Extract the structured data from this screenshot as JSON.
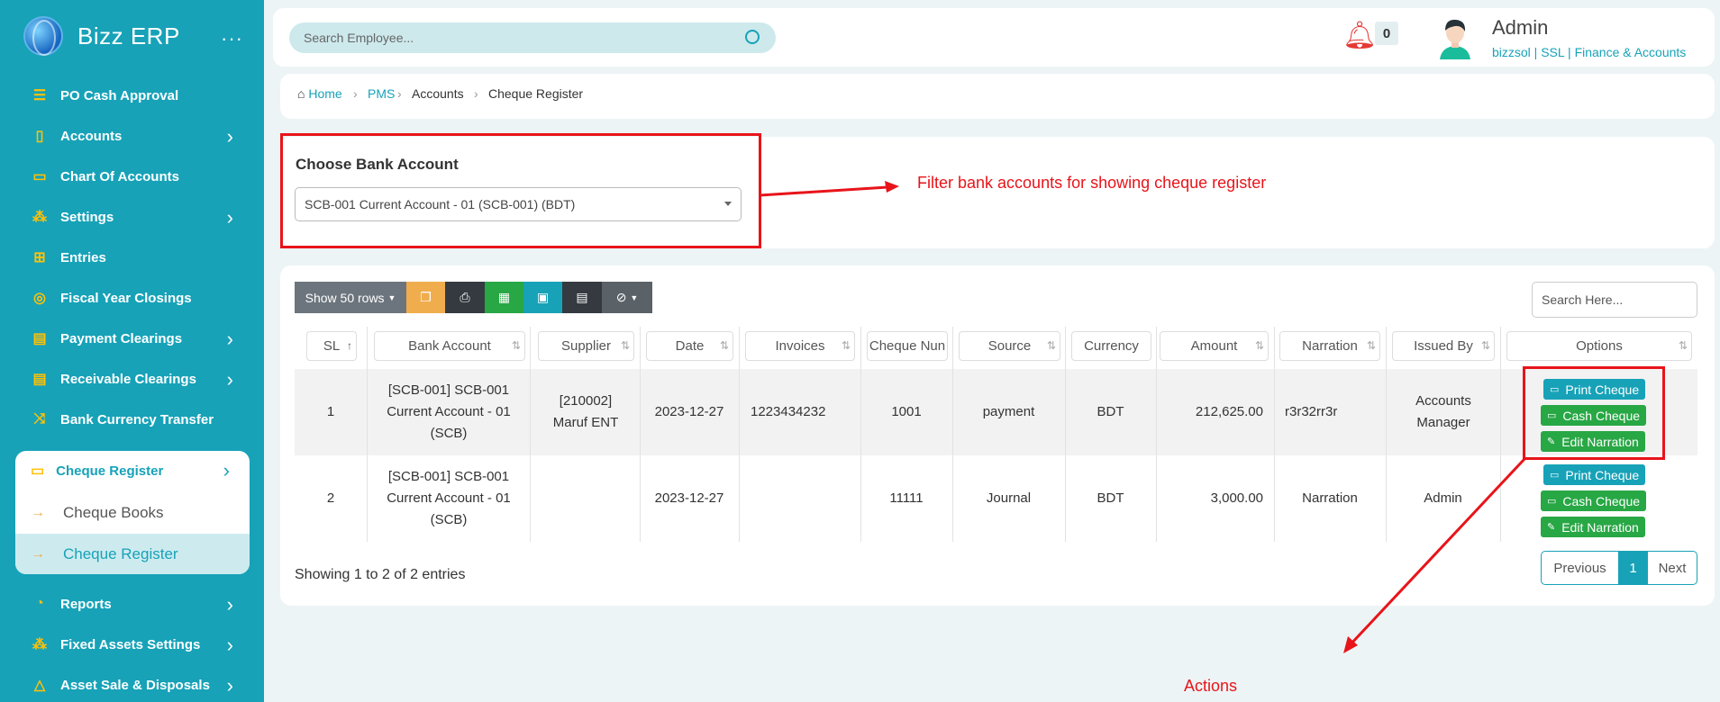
{
  "sidebar": {
    "brand": "Bizz ERP",
    "menu_dots": "···",
    "items": [
      {
        "label": "PO Cash Approval",
        "icon": "list-icon",
        "chevron": false
      },
      {
        "label": "Accounts",
        "icon": "clipboard-icon",
        "chevron": true
      },
      {
        "label": "Chart Of Accounts",
        "icon": "money-icon",
        "chevron": false
      },
      {
        "label": "Settings",
        "icon": "cubes-icon",
        "chevron": true
      },
      {
        "label": "Entries",
        "icon": "plus-square-icon",
        "chevron": false
      },
      {
        "label": "Fiscal Year Closings",
        "icon": "circle-icon",
        "chevron": false
      },
      {
        "label": "Payment Clearings",
        "icon": "invoice-icon",
        "chevron": true
      },
      {
        "label": "Receivable Clearings",
        "icon": "invoice-icon",
        "chevron": true
      },
      {
        "label": "Bank Currency Transfer",
        "icon": "shuffle-icon",
        "chevron": false
      }
    ],
    "submenu": {
      "label": "Cheque Register",
      "children": [
        {
          "label": "Cheque Books",
          "active": false
        },
        {
          "label": "Cheque Register",
          "active": true
        }
      ]
    },
    "bottom_items": [
      {
        "label": "Reports",
        "icon": "pie-chart-icon",
        "chevron": true
      },
      {
        "label": "Fixed Assets Settings",
        "icon": "cubes-icon",
        "chevron": true
      },
      {
        "label": "Asset Sale & Disposals",
        "icon": "warning-icon",
        "chevron": true
      }
    ]
  },
  "header": {
    "search_placeholder": "Search Employee...",
    "notification_count": "0",
    "user_name": "Admin",
    "user_sub": "bizzsol | SSL  | Finance & Accounts"
  },
  "breadcrumb": [
    "Home",
    "PMS",
    "Accounts",
    "Cheque Register"
  ],
  "filter": {
    "title": "Choose Bank Account",
    "selected": "SCB-001 Current Account - 01 (SCB-001) (BDT)"
  },
  "annotations": {
    "filter_note": "Filter bank accounts for showing cheque register",
    "actions_note": "Actions"
  },
  "toolbar": {
    "show_rows": "Show 50 rows",
    "search_placeholder": "Search Here..."
  },
  "table": {
    "columns": [
      "SL",
      "Bank Account",
      "Supplier",
      "Date",
      "Invoices",
      "Cheque Nun",
      "Source",
      "Currency",
      "Amount",
      "Narration",
      "Issued By",
      "Options"
    ],
    "rows": [
      {
        "sl": "1",
        "bank": "[SCB-001] SCB-001 Current Account - 01 (SCB)",
        "supplier": "[210002] Maruf ENT",
        "date": "2023-12-27",
        "invoices": "1223434232",
        "cheque": "1001",
        "source": "payment",
        "currency": "BDT",
        "amount": "212,625.00",
        "narration": "r3r32rr3r",
        "issued_by": "Accounts Manager"
      },
      {
        "sl": "2",
        "bank": "[SCB-001] SCB-001 Current Account - 01 (SCB)",
        "supplier": "",
        "date": "2023-12-27",
        "invoices": "",
        "cheque": "11111",
        "source": "Journal",
        "currency": "BDT",
        "amount": "3,000.00",
        "narration": "Narration",
        "issued_by": "Admin"
      }
    ],
    "actions": {
      "print": "Print Cheque",
      "cash": "Cash Cheque",
      "edit": "Edit Narration"
    }
  },
  "footer": {
    "showing": "Showing 1 to 2 of 2 entries",
    "previous": "Previous",
    "page": "1",
    "next": "Next"
  },
  "colors": {
    "brand": "#17a2b8",
    "accent": "#ffc107",
    "annotation": "#e8141a",
    "success": "#28a745"
  }
}
